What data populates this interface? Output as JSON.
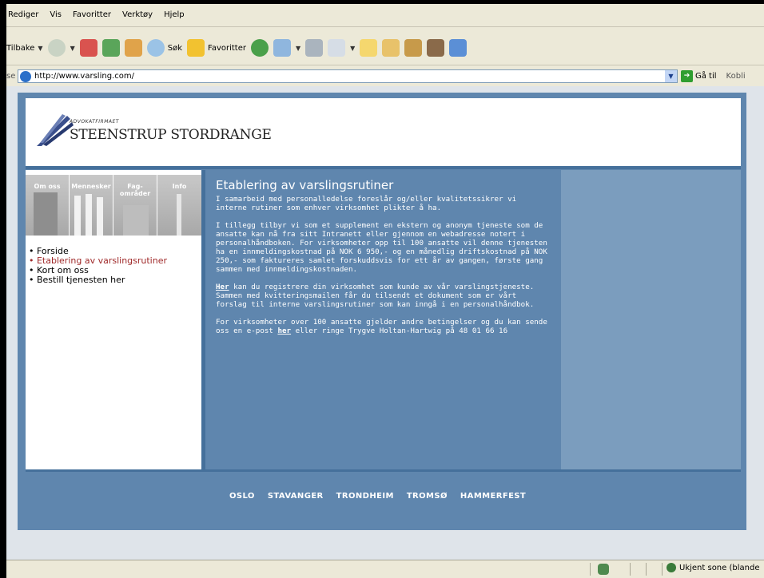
{
  "browser": {
    "menu": [
      "Rediger",
      "Vis",
      "Favoritter",
      "Verktøy",
      "Hjelp"
    ],
    "toolbar": {
      "back_label": "Tilbake",
      "search_label": "Søk",
      "favorites_label": "Favoritter"
    },
    "address": {
      "label": "se",
      "url": "http://www.varsling.com/",
      "go_label": "Gå til",
      "links_label": "Kobli"
    },
    "status": {
      "zone": "Ukjent sone (blande"
    }
  },
  "site": {
    "logo": {
      "tagline": "ADVOKATFIRMAET",
      "name": "STEENSTRUP STORDRANGE"
    },
    "tiles": [
      {
        "label": "Om oss"
      },
      {
        "label": "Mennesker"
      },
      {
        "label": "Fag-\nområder"
      },
      {
        "label": "Info"
      }
    ],
    "nav": [
      {
        "label": "• Forside"
      },
      {
        "label": "• Etablering av varslingsrutiner"
      },
      {
        "label": "• Kort om oss"
      },
      {
        "label": "• Bestill tjenesten her"
      }
    ],
    "content": {
      "title": "Etablering av varslingsrutiner",
      "p1": "I samarbeid med personalledelse foreslår og/eller kvalitetssikrer vi interne rutiner som enhver virksomhet plikter å ha.",
      "p2": "I tillegg tilbyr vi som et supplement en ekstern og anonym tjeneste som de ansatte kan nå fra sitt Intranett eller gjennom en webadresse notert i personalhåndboken. For virksomheter opp til 100 ansatte vil denne tjenesten ha en innmeldingskostnad på NOK 6 950,- og en månedlig driftskostnad på NOK 250,- som faktureres samlet forskuddsvis for ett år av gangen, første gang sammen med innmeldingskostnaden.",
      "p3_link": "Her",
      "p3_rest": " kan du registrere din virksomhet som kunde av vår varslingstjeneste. Sammen med kvitteringsmailen får du tilsendt et dokument som er vårt forslag til interne varslingsrutiner som kan inngå i en personalhåndbok.",
      "p4_a": "For virksomheter over 100 ansatte gjelder andre betingelser og du kan sende oss en e-post ",
      "p4_link": "her",
      "p4_b": " eller ringe Trygve Holtan-Hartwig på 48 01 66 16"
    },
    "footer": [
      "OSLO",
      "STAVANGER",
      "TRONDHEIM",
      "TROMSØ",
      "HAMMERFEST"
    ]
  },
  "colors": {
    "site_blue": "#5f86ae",
    "site_blue_dark": "#45709b",
    "site_blue_light": "#7b9dbe",
    "nav_active": "#a02a2a"
  }
}
